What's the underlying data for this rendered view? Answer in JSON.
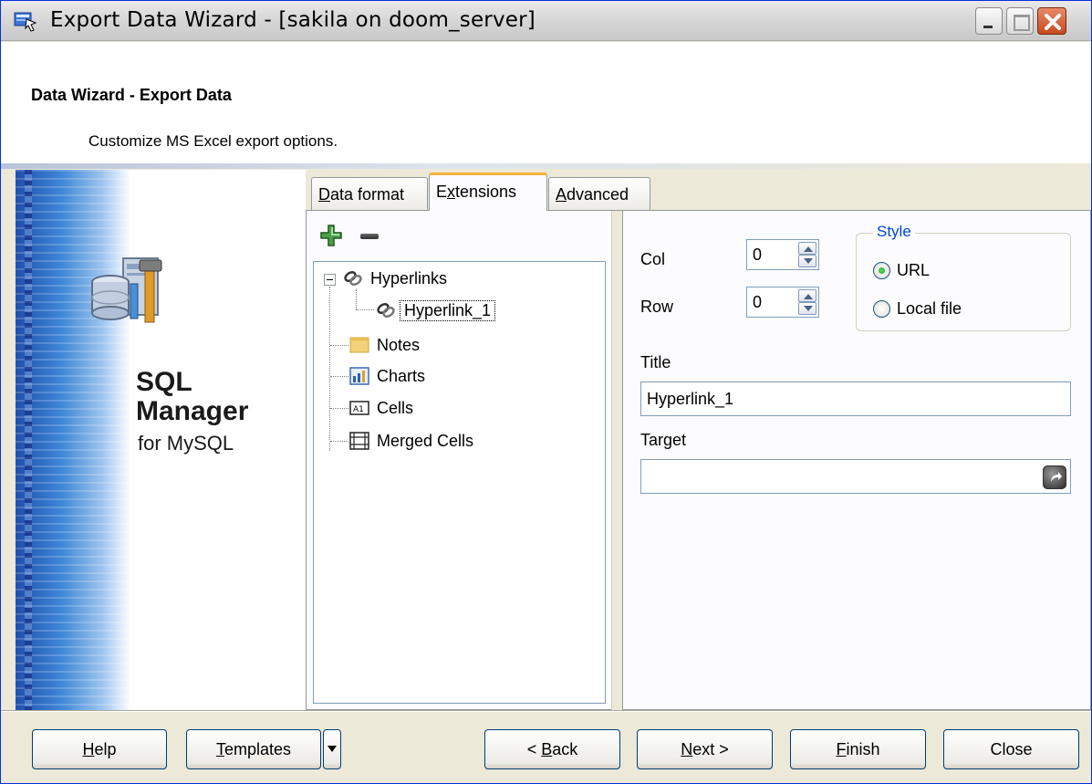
{
  "window": {
    "title": "Export Data Wizard - [sakila on doom_server]",
    "icons": [
      "wizard-app-icon",
      "minimize-icon",
      "maximize-icon",
      "close-icon"
    ]
  },
  "header": {
    "title": "Data Wizard - Export Data",
    "subtitle": "Customize MS Excel export options."
  },
  "banner": {
    "line1": "SQL",
    "line2": "Manager",
    "line3": "for MySQL"
  },
  "tabs": [
    {
      "label": "Data format",
      "accel": "D",
      "rest": "ata format"
    },
    {
      "label": "Extensions",
      "pre": "E",
      "accel": "x",
      "rest": "tensions",
      "selected": true
    },
    {
      "label": "Advanced",
      "accel": "A",
      "rest": "dvanced"
    }
  ],
  "toolbar": {
    "add_icon": "plus-icon",
    "remove_icon": "minus-icon"
  },
  "tree": {
    "hyperlinks": "Hyperlinks",
    "hyperlink_1": "Hyperlink_1",
    "notes": "Notes",
    "charts": "Charts",
    "cells": "Cells",
    "merged_cells": "Merged Cells"
  },
  "props": {
    "col_label": "Col",
    "col_value": "0",
    "row_label": "Row",
    "row_value": "0",
    "style_legend": "Style",
    "radio_url": "URL",
    "radio_local": "Local file",
    "selected_style": "URL",
    "title_label": "Title",
    "title_value": "Hyperlink_1",
    "target_label": "Target",
    "target_value": ""
  },
  "buttons": {
    "help": {
      "accel": "H",
      "rest": "elp"
    },
    "templates": {
      "accel": "T",
      "rest": "emplates"
    },
    "back": {
      "pre": "< ",
      "accel": "B",
      "rest": "ack"
    },
    "next": {
      "accel": "N",
      "rest": "ext >"
    },
    "finish": {
      "accel": "F",
      "rest": "inish"
    },
    "close": "Close"
  },
  "colors": {
    "accent_tab": "#f8b33c",
    "legend_blue": "#0046d5",
    "radio_green": "#21a121"
  }
}
